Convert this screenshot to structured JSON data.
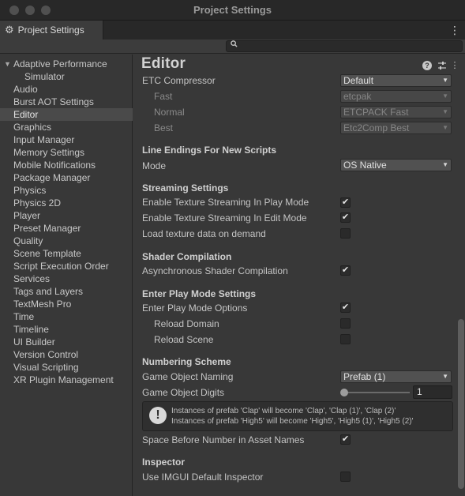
{
  "window": {
    "title": "Project Settings"
  },
  "tab": {
    "label": "Project Settings"
  },
  "search": {
    "placeholder": "",
    "value": ""
  },
  "sidebar": {
    "items": [
      {
        "label": "Adaptive Performance",
        "expanded": true
      },
      {
        "label": "Simulator"
      },
      {
        "label": "Audio"
      },
      {
        "label": "Burst AOT Settings"
      },
      {
        "label": "Editor",
        "selected": true
      },
      {
        "label": "Graphics"
      },
      {
        "label": "Input Manager"
      },
      {
        "label": "Memory Settings"
      },
      {
        "label": "Mobile Notifications"
      },
      {
        "label": "Package Manager"
      },
      {
        "label": "Physics"
      },
      {
        "label": "Physics 2D"
      },
      {
        "label": "Player"
      },
      {
        "label": "Preset Manager"
      },
      {
        "label": "Quality"
      },
      {
        "label": "Scene Template"
      },
      {
        "label": "Script Execution Order"
      },
      {
        "label": "Services"
      },
      {
        "label": "Tags and Layers"
      },
      {
        "label": "TextMesh Pro"
      },
      {
        "label": "Time"
      },
      {
        "label": "Timeline"
      },
      {
        "label": "UI Builder"
      },
      {
        "label": "Version Control"
      },
      {
        "label": "Visual Scripting"
      },
      {
        "label": "XR Plugin Management"
      }
    ]
  },
  "main": {
    "title": "Editor",
    "etc": {
      "label": "ETC Compressor",
      "value": "Default",
      "fast_label": "Fast",
      "fast_value": "etcpak",
      "normal_label": "Normal",
      "normal_value": "ETCPACK Fast",
      "best_label": "Best",
      "best_value": "Etc2Comp Best"
    },
    "line_endings": {
      "header": "Line Endings For New Scripts",
      "mode_label": "Mode",
      "mode_value": "OS Native"
    },
    "streaming": {
      "header": "Streaming Settings",
      "play_mode": {
        "label": "Enable Texture Streaming In Play Mode",
        "checked": true
      },
      "edit_mode": {
        "label": "Enable Texture Streaming In Edit Mode",
        "checked": true
      },
      "on_demand": {
        "label": "Load texture data on demand",
        "checked": false
      }
    },
    "shader": {
      "header": "Shader Compilation",
      "async": {
        "label": "Asynchronous Shader Compilation",
        "checked": true
      }
    },
    "play_mode": {
      "header": "Enter Play Mode Settings",
      "options": {
        "label": "Enter Play Mode Options",
        "checked": true
      },
      "reload_domain": {
        "label": "Reload Domain",
        "checked": false
      },
      "reload_scene": {
        "label": "Reload Scene",
        "checked": false
      }
    },
    "numbering": {
      "header": "Numbering Scheme",
      "naming_label": "Game Object Naming",
      "naming_value": "Prefab (1)",
      "digits_label": "Game Object Digits",
      "digits_value": "1",
      "help_line1": "Instances of prefab 'Clap' will become 'Clap', 'Clap (1)', 'Clap (2)'",
      "help_line2": "Instances of prefab 'High5' will become 'High5', 'High5 (1)', 'High5 (2)'",
      "space_before": {
        "label": "Space Before Number in Asset Names",
        "checked": true
      }
    },
    "inspector": {
      "header": "Inspector",
      "imgui": {
        "label": "Use IMGUI Default Inspector",
        "checked": false
      }
    }
  },
  "icons": {
    "checkmark": "✔",
    "caret": "▼",
    "gear": "⚙",
    "kebab": "⋮",
    "warning": "!",
    "help": "?",
    "sliders": "⇄",
    "search": "🔍",
    "expand": "▼"
  }
}
